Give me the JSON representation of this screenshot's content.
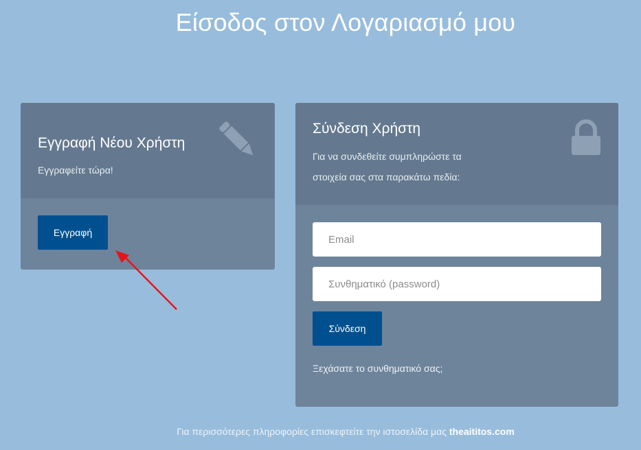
{
  "page": {
    "title": "Είσοδος στον Λογαριασμό μου"
  },
  "register": {
    "title": "Εγγραφή Νέου Χρήστη",
    "subtitle": "Εγγραφείτε τώρα!",
    "button_label": "Εγγραφή",
    "icon": "pencil-icon"
  },
  "login": {
    "title": "Σύνδεση Χρήστη",
    "subtitle_line1": "Για να συνδεθείτε συμπληρώστε τα",
    "subtitle_line2": "στοιχεία σας στα παρακάτω πεδία:",
    "email_placeholder": "Email",
    "password_placeholder": "Συνθηματικό (password)",
    "button_label": "Σύνδεση",
    "forgot_label": "Ξεχάσατε το συνθηματικό σας;",
    "icon": "lock-icon"
  },
  "footer": {
    "text": "Για περισσότερες πληροφορίες επισκεφτείτε την ιστοσελίδα μας",
    "site": "theaititos.com"
  },
  "colors": {
    "background": "#98bcdc",
    "card_header": "#64798f",
    "card_body": "#6e849b",
    "button": "#00508f",
    "annotation_arrow": "#e8141c"
  }
}
